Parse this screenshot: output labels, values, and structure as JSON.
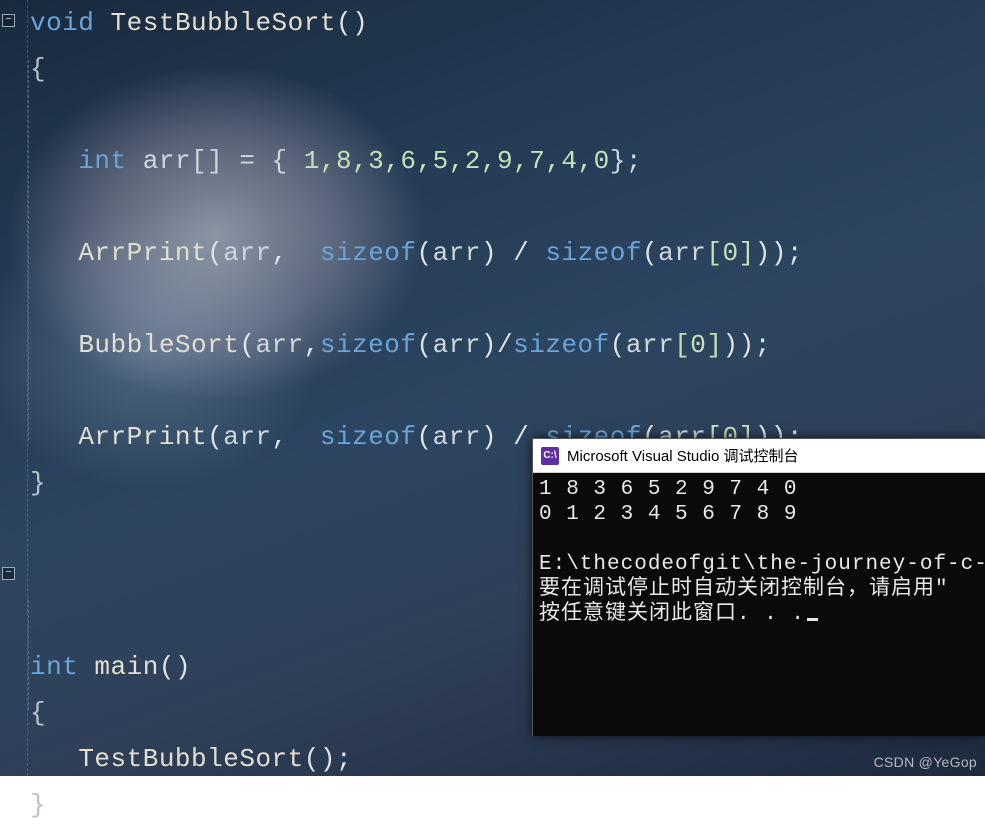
{
  "code": {
    "void": "void",
    "int": "int",
    "sizeof": "sizeof",
    "fn_test": "TestBubbleSort",
    "fn_print": "ArrPrint",
    "fn_sort": "BubbleSort",
    "fn_main": "main",
    "arr": "arr",
    "decl_lhs": "arr[] = { ",
    "decl_vals": "1,8,3,6,5,2,9,7,4,0",
    "decl_rhs": "};",
    "idx0": "[0]",
    "paren_o": "(",
    "paren_c": ")",
    "comma_sp": ", ",
    "comma": ",",
    "slash_sp": " / ",
    "slash": "/",
    "stmt_end": ");",
    "brace_o": "{",
    "brace_c": "}",
    "call_end": "();"
  },
  "console": {
    "title": "Microsoft Visual Studio 调试控制台",
    "icon_text": "C:\\",
    "line1": "1 8 3 6 5 2 9 7 4 0",
    "line2": "0 1 2 3 4 5 6 7 8 9",
    "line4": "E:\\thecodeofgit\\the-journey-of-c-langu",
    "line5": "要在调试停止时自动关闭控制台，请启用\"",
    "line6": "按任意键关闭此窗口. . ."
  },
  "watermark": "CSDN @YeGop",
  "folds": {
    "t1": "−",
    "t2": "−"
  }
}
